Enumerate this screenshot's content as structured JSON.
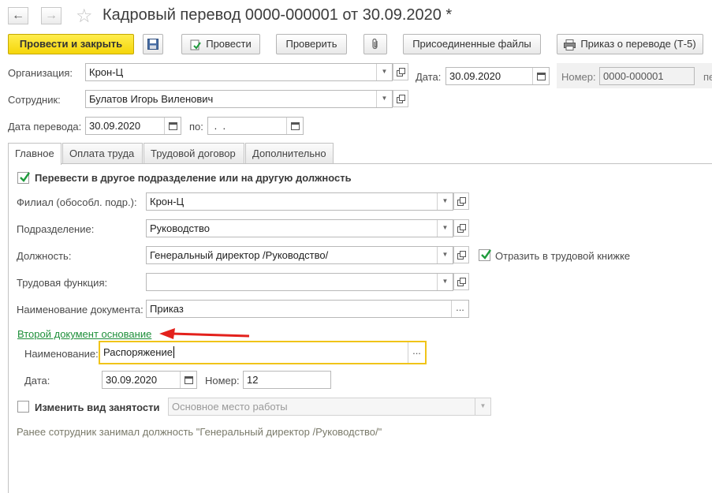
{
  "window": {
    "title": "Кадровый перевод 0000-000001 от 30.09.2020 *"
  },
  "toolbar": {
    "post_close": "Провести и закрыть",
    "post": "Провести",
    "check": "Проверить",
    "attached_files": "Присоединенные файлы",
    "print_order": "Приказ о переводе (Т-5)"
  },
  "header": {
    "organization_label": "Организация:",
    "organization_value": "Крон-Ц",
    "date_label": "Дата:",
    "date_value": "30.09.2020",
    "number_label": "Номер:",
    "number_value": "0000-000001",
    "cut_label": "пе",
    "employee_label": "Сотрудник:",
    "employee_value": "Булатов Игорь Виленович",
    "transfer_date_label": "Дата перевода:",
    "transfer_date_value": "30.09.2020",
    "to_label": "по:",
    "to_value": " .  . "
  },
  "tabs": [
    "Главное",
    "Оплата труда",
    "Трудовой договор",
    "Дополнительно"
  ],
  "main": {
    "transfer_check_label": "Перевести в другое подразделение или на другую должность",
    "transfer_checked": true,
    "branch_label": "Филиал (обособл. подр.):",
    "branch_value": "Крон-Ц",
    "department_label": "Подразделение:",
    "department_value": "Руководство",
    "position_label": "Должность:",
    "position_value": "Генеральный директор /Руководство/",
    "workbook_label": "Отразить в трудовой книжке",
    "workbook_checked": true,
    "labor_function_label": "Трудовая функция:",
    "labor_function_value": "",
    "doc_name_label": "Наименование документа:",
    "doc_name_value": "Приказ",
    "second_doc_link": "Второй документ основание",
    "name_label": "Наименование:",
    "name_value": "Распоряжение",
    "date_label": "Дата:",
    "date_value": "30.09.2020",
    "number_label": "Номер:",
    "number_value": "12",
    "change_employment_label": "Изменить вид занятости",
    "change_employment_checked": false,
    "employment_value": "Основное место работы",
    "previous_note": "Ранее сотрудник занимал должность \"Генеральный директор /Руководство/\""
  },
  "colors": {
    "primary_button": "#f5d60a",
    "link": "#1e8f3a",
    "focus_border": "#f0c419",
    "arrow": "#e3211c"
  },
  "icons": [
    "back-arrow-icon",
    "forward-arrow-icon",
    "favorite-star-icon",
    "save-disk-icon",
    "post-document-icon",
    "paperclip-icon",
    "printer-icon",
    "calendar-icon",
    "open-link-icon",
    "checkmark-icon",
    "red-arrow-icon"
  ]
}
